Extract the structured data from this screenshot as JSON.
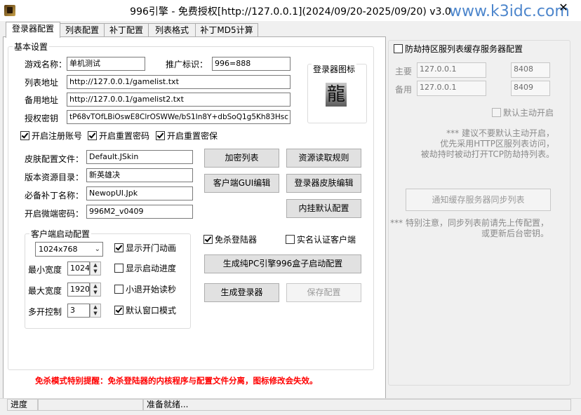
{
  "window": {
    "title": "996引擎 - 免费授权[http://127.0.0.1](2024/09/20-2025/09/20) v3.0",
    "watermark": "www.k3idc.com",
    "close_glyph": "✕"
  },
  "tabs": [
    {
      "label": "登录器配置",
      "active": true
    },
    {
      "label": "列表配置"
    },
    {
      "label": "补丁配置"
    },
    {
      "label": "列表格式"
    },
    {
      "label": "补丁MD5计算"
    }
  ],
  "basic": {
    "title": "基本设置",
    "game_name_label": "游戏名称：",
    "game_name_value": "单机测试",
    "promo_label": "推广标识：",
    "promo_value": "996=888",
    "list_addr_label": "列表地址",
    "list_addr_value": "http://127.0.0.1/gamelist.txt",
    "backup_addr_label": "备用地址",
    "backup_addr_value": "http://127.0.0.1/gamelist2.txt",
    "license_key_label": "授权密钥",
    "license_key_value": "tP68vTOfLBiOswE8ClrOSWWe/bS1In8Y+dbSoQ1g5Kh83Hsc",
    "icon_label": "登录器图标",
    "icon_glyph": "龍"
  },
  "checks_top": [
    {
      "label": "开启注册账号",
      "checked": true
    },
    {
      "label": "开启重置密码",
      "checked": true
    },
    {
      "label": "开启重置密保",
      "checked": true
    }
  ],
  "resources": {
    "skin_label": "皮肤配置文件：",
    "skin_value": "Default.JSkin",
    "version_label": "版本资源目录：",
    "version_value": "新英雄决",
    "patch_label": "必备补丁名称：",
    "patch_value": "NewopUI.Jpk",
    "micro_pwd_label": "开启微端密码：",
    "micro_pwd_value": "996M2_v0409"
  },
  "buttons": {
    "encrypt_list": "加密列表",
    "resource_rules": "资源读取规则",
    "client_gui_edit": "客户端GUI编辑",
    "launcher_skin_edit": "登录器皮肤编辑",
    "hook_default": "内挂默认配置",
    "gen_pc_config": "生成纯PC引擎996盒子启动配置",
    "gen_launcher": "生成登录器",
    "save_config": "保存配置"
  },
  "client": {
    "title": "客户端启动配置",
    "resolution": "1024x768",
    "min_width_label": "最小宽度",
    "min_width_value": "1024",
    "max_width_label": "最大宽度",
    "max_width_value": "1920",
    "multi_label": "多开控制",
    "multi_value": "3",
    "show_door_anim": {
      "label": "显示开门动画",
      "checked": true
    },
    "show_progress": {
      "label": "显示启动进度",
      "checked": false
    },
    "exit_countdown": {
      "label": "小退开始读秒",
      "checked": false
    },
    "default_window": {
      "label": "默认窗口模式",
      "checked": true
    }
  },
  "middle_checks": {
    "anti_kill": {
      "label": "免杀登陆器",
      "checked": true
    },
    "real_name": {
      "label": "实名认证客户端",
      "checked": false
    }
  },
  "warning": "免杀模式特别提醒：免杀登陆器的内核程序与配置文件分离，图标修改会失效。",
  "cache_server": {
    "title": "防劫持区服列表缓存服务器配置",
    "enabled": false,
    "main_label": "主要",
    "main_ip": "127.0.0.1",
    "main_port": "8408",
    "backup_label": "备用",
    "backup_ip": "127.0.0.1",
    "backup_port": "8409",
    "auto_start": {
      "label": "默认主动开启",
      "checked": false
    },
    "note1": [
      "***  建议不要默认主动开启，",
      "优先采用HTTP区服列表访问，",
      "被劫持时被动打开TCP防劫持列表。"
    ],
    "notify_button": "通知缓存服务器同步列表",
    "note2": [
      "***  特别注意，同步列表前请先上传配置，",
      "或更新后台密钥。"
    ]
  },
  "status": {
    "progress_label": "进度",
    "message": "准备就绪..."
  }
}
